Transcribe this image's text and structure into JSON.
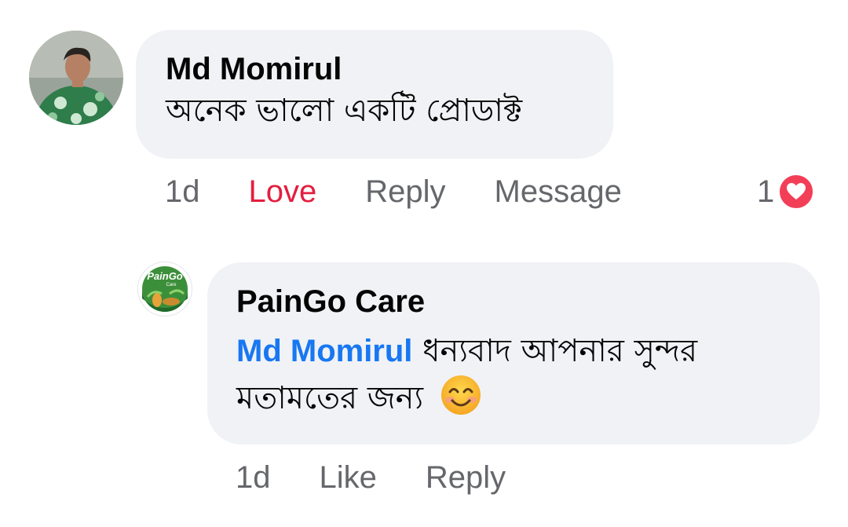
{
  "comment": {
    "author": "Md Momirul",
    "text": "অনেক ভালো একটি প্রোডাক্ট",
    "time": "1d",
    "love_label": "Love",
    "reply_label": "Reply",
    "message_label": "Message",
    "reaction_count": "1",
    "reaction_icon": "heart-icon"
  },
  "reply": {
    "author": "PainGo Care",
    "avatar_logo_text": "PainGo",
    "avatar_logo_sub": "Care",
    "mention": "Md Momirul",
    "text": "ধন্যবাদ আপনার সুন্দর মতামতের জন্য",
    "emoji": "smiling-face-icon",
    "time": "1d",
    "like_label": "Like",
    "reply_label": "Reply"
  },
  "colors": {
    "bubble_bg": "#f0f2f5",
    "love": "#e41e3f",
    "mention": "#1877f2",
    "meta": "#65676b",
    "heart_badge": "#f33e58"
  }
}
